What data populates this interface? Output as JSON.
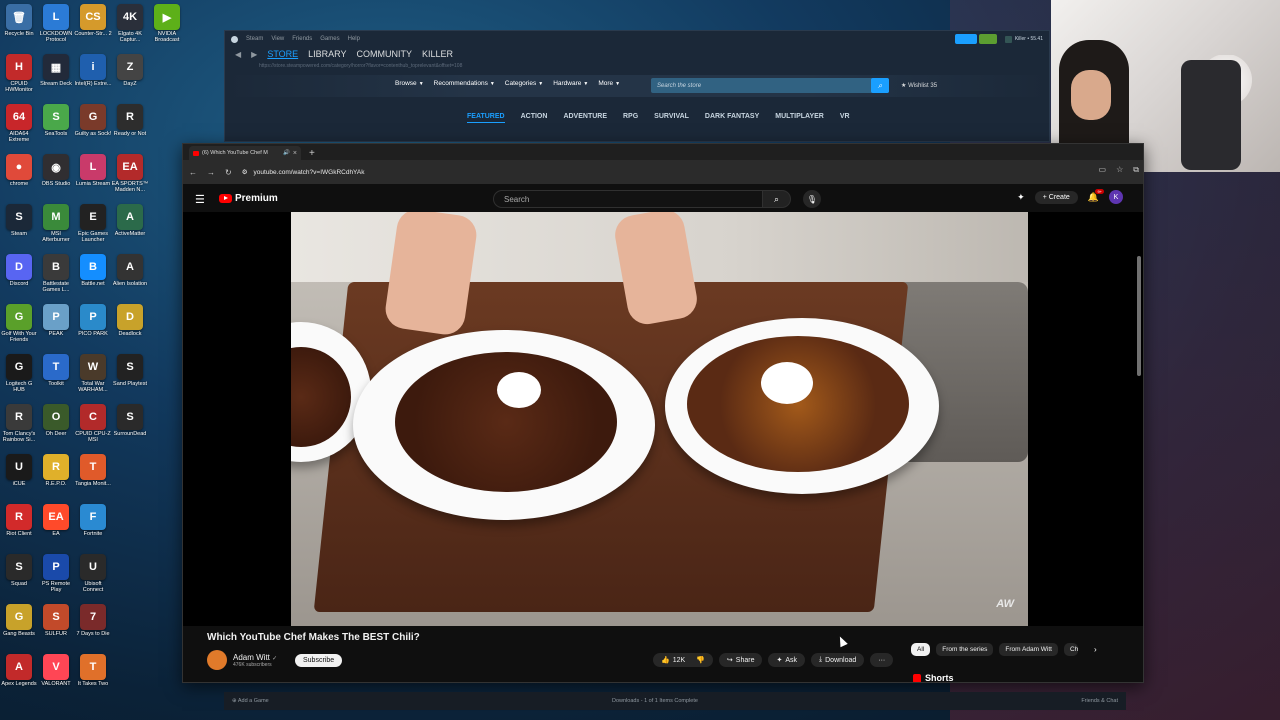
{
  "desktop": {
    "icons": [
      {
        "label": "Recycle Bin",
        "glyph": "🗑",
        "color": "#3a6ea5"
      },
      {
        "label": "LOCKDOWN Protocol",
        "glyph": "L",
        "color": "#2b7bd6"
      },
      {
        "label": "Counter-Str... 2",
        "glyph": "CS",
        "color": "#d59a2b"
      },
      {
        "label": "Elgato 4K Captur...",
        "glyph": "4K",
        "color": "#2a2f3a"
      },
      {
        "label": "NVIDIA Broadcast",
        "glyph": "▶",
        "color": "#5db019"
      },
      {
        "label": "CPUID HWMonitor",
        "glyph": "H",
        "color": "#c22a2a"
      },
      {
        "label": "Stream Deck",
        "glyph": "▦",
        "color": "#222a3a"
      },
      {
        "label": "Intel(R) Extre...",
        "glyph": "i",
        "color": "#1f5fae"
      },
      {
        "label": "DayZ",
        "glyph": "Z",
        "color": "#444"
      },
      {
        "label": "AIDA64 Extreme",
        "glyph": "64",
        "color": "#c8262a"
      },
      {
        "label": "SeaTools",
        "glyph": "S",
        "color": "#4aa84a"
      },
      {
        "label": "Guilty as Sock!",
        "glyph": "G",
        "color": "#7a3a2a"
      },
      {
        "label": "Ready or Not",
        "glyph": "R",
        "color": "#2d2d2d"
      },
      {
        "label": "chrome",
        "glyph": "●",
        "color": "#e04a3a"
      },
      {
        "label": "OBS Studio",
        "glyph": "◉",
        "color": "#302e31"
      },
      {
        "label": "Lumia Stream",
        "glyph": "L",
        "color": "#c93a6a"
      },
      {
        "label": "EA SPORTS™ Madden N...",
        "glyph": "EA",
        "color": "#b32a2a"
      },
      {
        "label": "Steam",
        "glyph": "S",
        "color": "#1b2838"
      },
      {
        "label": "MSI Afterburner",
        "glyph": "M",
        "color": "#3a8a3a"
      },
      {
        "label": "Epic Games Launcher",
        "glyph": "E",
        "color": "#222"
      },
      {
        "label": "ActiveMatter",
        "glyph": "A",
        "color": "#2b6a4a"
      },
      {
        "label": "Discord",
        "glyph": "D",
        "color": "#5865f2"
      },
      {
        "label": "Battlestate Games L...",
        "glyph": "B",
        "color": "#3a3a3a"
      },
      {
        "label": "Battle.net",
        "glyph": "B",
        "color": "#148eff"
      },
      {
        "label": "Alien Isolation",
        "glyph": "A",
        "color": "#333"
      },
      {
        "label": "Golf With Your Friends",
        "glyph": "G",
        "color": "#5aa02a"
      },
      {
        "label": "PEAK",
        "glyph": "P",
        "color": "#6aa0c8"
      },
      {
        "label": "PICO PARK",
        "glyph": "P",
        "color": "#2a8aca"
      },
      {
        "label": "Deadlock",
        "glyph": "D",
        "color": "#c8a22a"
      },
      {
        "label": "Logitech G HUB",
        "glyph": "G",
        "color": "#1a1a1a"
      },
      {
        "label": "Toolkit",
        "glyph": "T",
        "color": "#2a6aca"
      },
      {
        "label": "Total War WARHAM...",
        "glyph": "W",
        "color": "#4a3a2a"
      },
      {
        "label": "Sand Playtest",
        "glyph": "S",
        "color": "#222"
      },
      {
        "label": "Tom Clancy's Rainbow Si...",
        "glyph": "R",
        "color": "#3a3a3a"
      },
      {
        "label": "Oh Deer",
        "glyph": "O",
        "color": "#3a5a2a"
      },
      {
        "label": "CPUID CPU-Z MSI",
        "glyph": "C",
        "color": "#b22a2a"
      },
      {
        "label": "SurrounDead",
        "glyph": "S",
        "color": "#2a2a2a"
      },
      {
        "label": "iCUE",
        "glyph": "U",
        "color": "#1a1a1a"
      },
      {
        "label": "R.E.P.O.",
        "glyph": "R",
        "color": "#e0b02a"
      },
      {
        "label": "Tangia Monit...",
        "glyph": "T",
        "color": "#e05a2a"
      },
      {
        "label": "Riot Client",
        "glyph": "R",
        "color": "#d22a2a"
      },
      {
        "label": "EA",
        "glyph": "EA",
        "color": "#ff4a2a"
      },
      {
        "label": "Fortnite",
        "glyph": "F",
        "color": "#2a8ad2"
      },
      {
        "label": "Squad",
        "glyph": "S",
        "color": "#2a2a2a"
      },
      {
        "label": "PS Remote Play",
        "glyph": "P",
        "color": "#1a4aaa"
      },
      {
        "label": "Ubisoft Connect",
        "glyph": "U",
        "color": "#2a2a2a"
      },
      {
        "label": "Gang Beasts",
        "glyph": "G",
        "color": "#c8a22a"
      },
      {
        "label": "SULFUR",
        "glyph": "S",
        "color": "#c24a2a"
      },
      {
        "label": "7 Days to Die",
        "glyph": "7",
        "color": "#7a2a2a"
      },
      {
        "label": "Apex Legends",
        "glyph": "A",
        "color": "#c22a2a"
      },
      {
        "label": "VALORANT",
        "glyph": "V",
        "color": "#ff4655"
      },
      {
        "label": "It Takes Two",
        "glyph": "T",
        "color": "#e0702a"
      }
    ]
  },
  "steam": {
    "menu": [
      "Steam",
      "View",
      "Friends",
      "Games",
      "Help"
    ],
    "account": "Killer • 55.41",
    "nav": [
      "STORE",
      "LIBRARY",
      "COMMUNITY",
      "KILLER"
    ],
    "url": "https://store.steampowered.com/category/horror?flavor=contenthub_toprelevant&offset=108",
    "store_nav": [
      "Browse",
      "Recommendations",
      "Categories",
      "Hardware",
      "More"
    ],
    "search_placeholder": "Search the store",
    "wishlist": "Wishlist 35",
    "tabs": [
      "FEATURED",
      "ACTION",
      "ADVENTURE",
      "RPG",
      "SURVIVAL",
      "DARK FANTASY",
      "MULTIPLAYER",
      "VR"
    ],
    "bottom": {
      "add_game": "Add a Game",
      "downloads": "Downloads - 1 of 1 Items Complete",
      "friends": "Friends & Chat"
    }
  },
  "browser": {
    "tab_title": "(6) Which YouTube Chef M",
    "url": "youtube.com/watch?v=IWGkRCdhYAk"
  },
  "youtube": {
    "brand": "Premium",
    "search_placeholder": "Search",
    "create_label": "Create",
    "notif_count": "9+",
    "account_initial": "K",
    "video_title": "Which YouTube Chef Makes The BEST Chili?",
    "watermark": "AW",
    "channel_name": "Adam Witt",
    "channel_verified": "✓",
    "subscribers": "476K subscribers",
    "subscribe_label": "Subscribe",
    "likes": "12K",
    "share_label": "Share",
    "ask_label": "Ask",
    "download_label": "Download",
    "more_label": "···",
    "chips": [
      "All",
      "From the series",
      "From Adam Witt",
      "Chili"
    ],
    "shorts_label": "Shorts"
  }
}
